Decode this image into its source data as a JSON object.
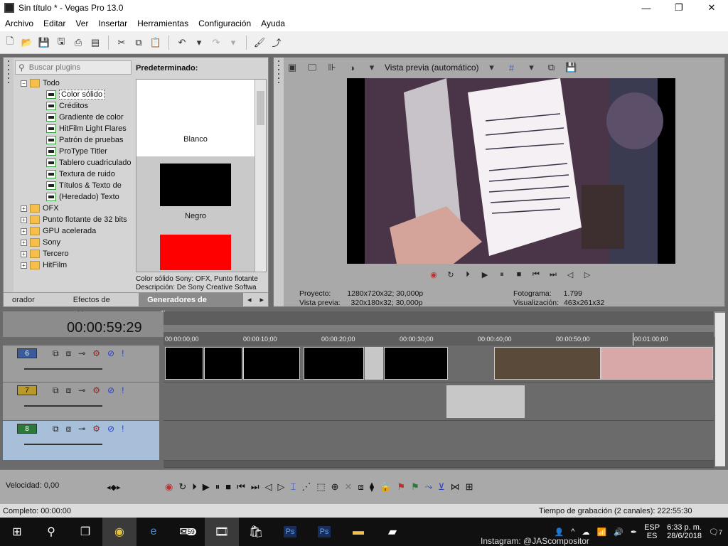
{
  "window": {
    "title": "Sin título * - Vegas Pro 13.0",
    "minimize": "—",
    "maximize": "❐",
    "close": "✕"
  },
  "menu": [
    "Archivo",
    "Editar",
    "Ver",
    "Insertar",
    "Herramientas",
    "Configuración",
    "Ayuda"
  ],
  "plugins": {
    "search_placeholder": "Buscar plugins",
    "presets_header": "Predeterminado:",
    "tree": [
      {
        "label": "Todo",
        "type": "folder",
        "expand": "−",
        "level": 0
      },
      {
        "label": "Color sólido",
        "type": "plugin",
        "level": 1,
        "selected": true
      },
      {
        "label": "Créditos",
        "type": "plugin",
        "level": 1
      },
      {
        "label": "Gradiente de color",
        "type": "plugin",
        "level": 1
      },
      {
        "label": "HitFilm Light Flares",
        "type": "plugin",
        "level": 1
      },
      {
        "label": "Patrón de pruebas",
        "type": "plugin",
        "level": 1
      },
      {
        "label": "ProType Titler",
        "type": "plugin",
        "level": 1
      },
      {
        "label": "Tablero cuadriculado",
        "type": "plugin",
        "level": 1
      },
      {
        "label": "Textura de ruido",
        "type": "plugin",
        "level": 1
      },
      {
        "label": "Títulos & Texto de",
        "type": "plugin",
        "level": 1
      },
      {
        "label": "(Heredado) Texto",
        "type": "plugin",
        "level": 1
      },
      {
        "label": "OFX",
        "type": "folder",
        "expand": "+",
        "level": 0
      },
      {
        "label": "Punto flotante de 32 bits",
        "type": "folder",
        "expand": "+",
        "level": 0
      },
      {
        "label": "GPU acelerada",
        "type": "folder",
        "expand": "+",
        "level": 0
      },
      {
        "label": "Sony",
        "type": "folder",
        "expand": "+",
        "level": 0
      },
      {
        "label": "Tercero",
        "type": "folder",
        "expand": "+",
        "level": 0
      },
      {
        "label": "HitFilm",
        "type": "folder",
        "expand": "+",
        "level": 0
      }
    ],
    "presets": [
      {
        "label": "Blanco",
        "color": "#ffffff"
      },
      {
        "label": "Negro",
        "color": "#000000"
      },
      {
        "label": "",
        "color": "#ff0000"
      }
    ],
    "description_line1": "Color sólido Sony: OFX, Punto flotante",
    "description_line2": "Descripción: De Sony Creative Softwa",
    "tabs": [
      "orador",
      "Efectos de vídeo",
      "Generadores de medios"
    ]
  },
  "preview": {
    "mode_label": "Vista previa (automático)",
    "project_label": "Proyecto:",
    "project_value": "1280x720x32; 30,000p",
    "preview_label": "Vista previa:",
    "preview_value": "320x180x32; 30,000p",
    "frame_label": "Fotograma:",
    "frame_value": "1.799",
    "display_label": "Visualización:",
    "display_value": "463x261x32"
  },
  "timeline": {
    "timecode": "00:00:59:29",
    "ticks": [
      "00:00:00;00",
      "00:00:10;00",
      "00:00:20;00",
      "00:00:30;00",
      "00:00:40;00",
      "00:00:50;00",
      "00:01:00;00"
    ],
    "tracks": [
      "6",
      "7",
      "8"
    ]
  },
  "transport": {
    "rate_label": "Velocidad: 0,00"
  },
  "status": {
    "complete": "Completo: 00:00:00",
    "record_time": "Tiempo de grabación (2 canales): 222:55:30"
  },
  "taskbar": {
    "lang1": "ESP",
    "lang2": "ES",
    "time": "6:33 p. m.",
    "date": "28/6/2018",
    "mail_badge": "59",
    "notif_badge": "7",
    "watermark": "Instagram: @JAScompositor"
  }
}
